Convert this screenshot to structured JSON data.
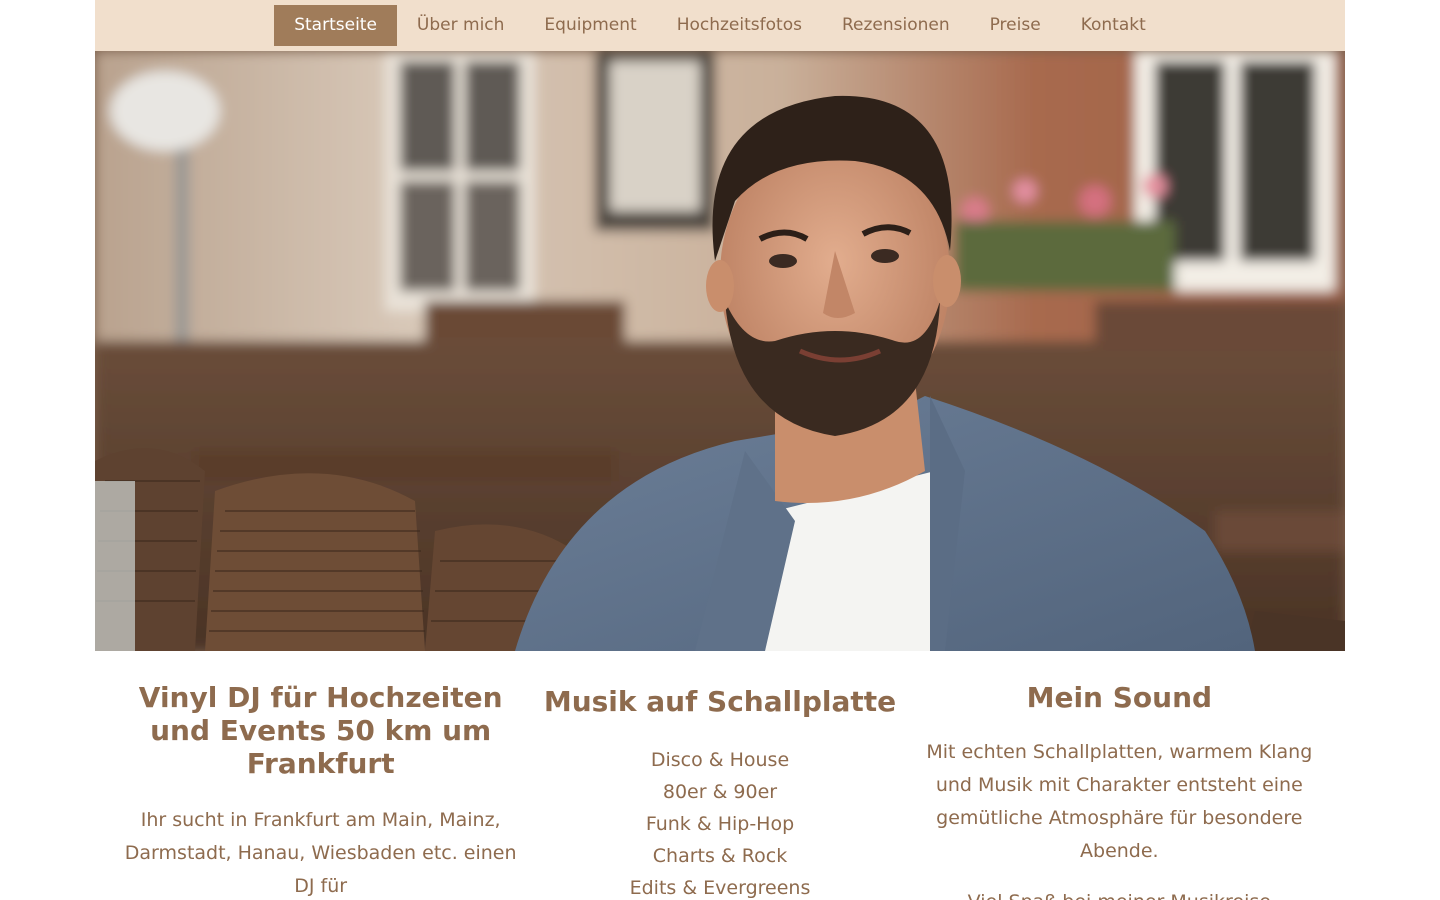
{
  "nav": {
    "items": [
      {
        "label": "Startseite",
        "active": true
      },
      {
        "label": "Über mich",
        "active": false
      },
      {
        "label": "Equipment",
        "active": false
      },
      {
        "label": "Hochzeitsfotos",
        "active": false
      },
      {
        "label": "Rezensionen",
        "active": false
      },
      {
        "label": "Preise",
        "active": false
      },
      {
        "label": "Kontakt",
        "active": false
      }
    ]
  },
  "colors": {
    "nav_bg": "#f1dfcc",
    "nav_active_bg": "#a07c5a",
    "text_brown": "#8e6b4e"
  },
  "col1": {
    "title": "Vinyl DJ für Hochzeiten und Events 50 km um Frankfurt",
    "text": "Ihr sucht in Frankfurt am Main, Mainz, Darmstadt, Hanau, Wiesbaden etc. einen DJ für"
  },
  "col2": {
    "title": "Musik auf Schallplatte",
    "genres": [
      "Disco & House",
      "80er & 90er",
      "Funk & Hip-Hop",
      "Charts & Rock",
      "Edits & Evergreens"
    ]
  },
  "col3": {
    "title": "Mein Sound",
    "text1": "Mit echten Schallplatten, warmem Klang und Musik mit Charakter entsteht eine gemütliche Atmosphäre für besondere Abende.",
    "text2": "Viel Spaß bei meiner Musikreise"
  }
}
